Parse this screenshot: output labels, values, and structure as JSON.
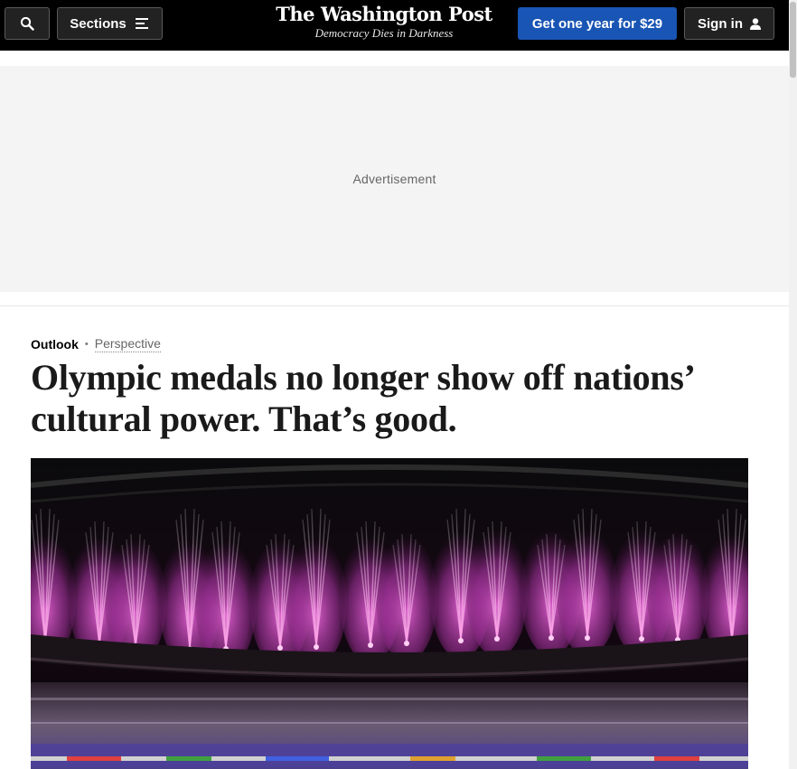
{
  "header": {
    "sections_label": "Sections",
    "brand_name": "The Washington Post",
    "brand_tagline": "Democracy Dies in Darkness",
    "subscribe_label": "Get one year for $29",
    "signin_label": "Sign in"
  },
  "ad": {
    "label": "Advertisement"
  },
  "article": {
    "section": "Outlook",
    "label": "Perspective",
    "headline": "Olympic medals no longer show off nations’ cultural power. That’s good."
  },
  "icons": {
    "search": "search-icon",
    "sections": "menu-lines-icon",
    "signin": "user-icon"
  },
  "colors": {
    "topbar": "#000000",
    "subscribe": "#1955b4",
    "ad_background": "#f4f4f4",
    "fireworks": "#d94fc4"
  }
}
